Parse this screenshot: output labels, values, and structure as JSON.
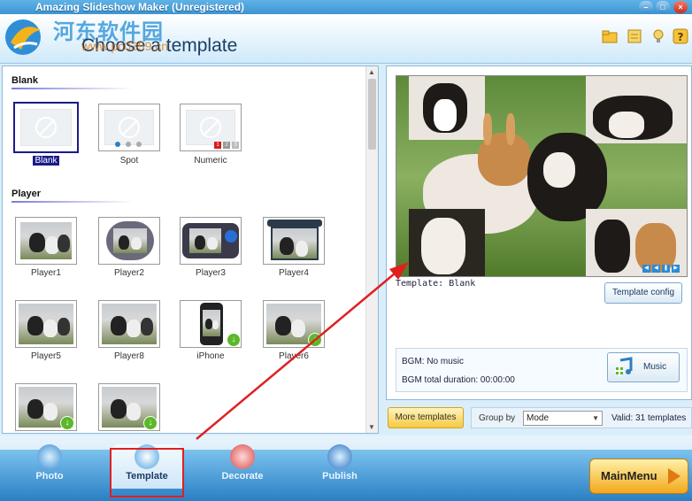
{
  "window": {
    "title": "Amazing Slideshow Maker (Unregistered)"
  },
  "header": {
    "page_title": "Choose a template",
    "watermark": "河东软件园",
    "watermark_url": "www.pc0359.cn"
  },
  "sections": [
    {
      "label": "Blank"
    },
    {
      "label": "Player"
    }
  ],
  "blank_templates": [
    {
      "label": "Blank",
      "selected": true
    },
    {
      "label": "Spot"
    },
    {
      "label": "Numeric"
    }
  ],
  "player_templates": [
    {
      "label": "Player1"
    },
    {
      "label": "Player2"
    },
    {
      "label": "Player3"
    },
    {
      "label": "Player4"
    },
    {
      "label": "Player5"
    },
    {
      "label": "Player8"
    },
    {
      "label": "iPhone"
    },
    {
      "label": "Player6"
    },
    {
      "label": ""
    },
    {
      "label": ""
    }
  ],
  "preview": {
    "template_label": "Template: Blank",
    "config_button": "Template config",
    "bgm_label": "BGM: No music",
    "bgm_duration": "BGM total duration: 00:00:00",
    "music_button": "Music"
  },
  "toolbar": {
    "more_templates": "More templates",
    "group_by_label": "Group by",
    "group_by_value": "Mode",
    "valid_count": "Valid: 31 templates"
  },
  "nav": {
    "tabs": [
      {
        "label": "Photo"
      },
      {
        "label": "Template",
        "active": true
      },
      {
        "label": "Decorate"
      },
      {
        "label": "Publish"
      }
    ],
    "main_menu": "MainMenu"
  },
  "colors": {
    "accent": "#2a7fc4",
    "selection": "#1a1a8a",
    "highlight_red": "#e02020"
  }
}
